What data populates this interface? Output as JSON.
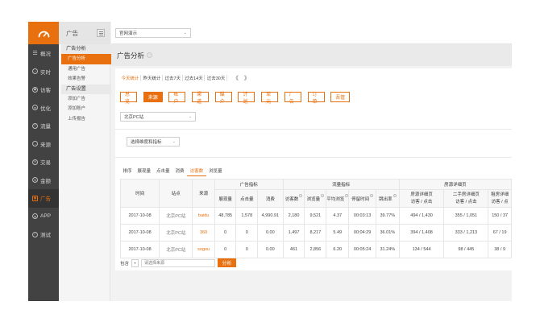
{
  "nav": {
    "items": [
      {
        "icon": "list-icon",
        "glyph": "☰",
        "label": "概况"
      },
      {
        "icon": "clock-icon",
        "glyph": "◔",
        "label": "实时"
      },
      {
        "icon": "visitor-icon",
        "glyph": "◉",
        "label": "访客"
      },
      {
        "icon": "optimize-icon",
        "glyph": "●",
        "label": "优化"
      },
      {
        "icon": "traffic-icon",
        "glyph": "≡",
        "label": "流量"
      },
      {
        "icon": "source-icon",
        "glyph": "→",
        "label": "来源"
      },
      {
        "icon": "deal-icon",
        "glyph": "¥",
        "label": "交易"
      },
      {
        "icon": "amount-icon",
        "glyph": "$",
        "label": "金额"
      },
      {
        "icon": "ad-icon",
        "glyph": "▣",
        "label": "广告"
      },
      {
        "icon": "app-icon",
        "glyph": "▲",
        "label": "APP"
      },
      {
        "icon": "test-icon",
        "glyph": "✓",
        "label": "测试"
      }
    ],
    "active_index": 8,
    "accent": "#e8700f"
  },
  "subnav": {
    "title": "广告",
    "groups": [
      {
        "title": "广告分析",
        "links": [
          "广告分析",
          "通用广告",
          "效果告警"
        ]
      },
      {
        "title": "广告设置",
        "links": [
          "添加广告",
          "添加账户",
          "上传报告"
        ]
      }
    ],
    "active_link": "广告分析"
  },
  "topbar": {
    "site_select": "官网演示"
  },
  "page_title": "广告分析",
  "date_range": {
    "options": [
      "今天统计",
      "昨天统计",
      "过去7天",
      "过去14天",
      "过去30天"
    ],
    "active": 0,
    "prev": "《",
    "next": "》"
  },
  "dimension_tags": [
    "总览",
    "来源",
    "账户",
    "渠道",
    "媒介",
    "计划",
    "单元",
    "广告",
    "订单",
    "吾管"
  ],
  "active_tag": 1,
  "station_select": "北京PC站",
  "dimension_select": "选择维度和指标",
  "metric_tabs": [
    "排序",
    "展现量",
    "点击量",
    "消费",
    "访客数",
    "浏览量"
  ],
  "active_metric_tab": 4,
  "table": {
    "headers": {
      "time": "时间",
      "station": "站点",
      "source": "来源",
      "group_ad": "广告指标",
      "group_flow": "流量指标",
      "group_house": "房源详细页",
      "ad_cols": [
        "展现量",
        "点击量",
        "消费"
      ],
      "flow_cols": [
        "访客数",
        "浏览量",
        "平均浏览",
        "停留时间",
        "跳出率"
      ],
      "house_cols": [
        "房源详细页\n访客 / 点击",
        "二手房详细页\n访客 / 点击",
        "租房详细\n访客 / 点"
      ]
    },
    "rows": [
      {
        "time": "2017-10-08",
        "station": "北京PC站",
        "source": "baidu",
        "impressions": "48,785",
        "clicks": "1,578",
        "cost": "4,990.91",
        "visitors": "2,180",
        "pageviews": "9,521",
        "avg_pv": "4.37",
        "stay": "00:03:13",
        "bounce": "39.77%",
        "house": "494 / 1,430",
        "second_hand": "355 / 1,051",
        "rent": "150 / 37"
      },
      {
        "time": "2017-10-08",
        "station": "北京PC站",
        "source": "360",
        "impressions": "0",
        "clicks": "0",
        "cost": "0.00",
        "visitors": "1,497",
        "pageviews": "8,217",
        "avg_pv": "5.49",
        "stay": "00:04:29",
        "bounce": "36.01%",
        "house": "394 / 1,408",
        "second_hand": "333 / 1,213",
        "rent": "67 / 19"
      },
      {
        "time": "2017-10-08",
        "station": "北京PC站",
        "source": "sogou",
        "impressions": "0",
        "clicks": "0",
        "cost": "0.00",
        "visitors": "461",
        "pageviews": "2,856",
        "avg_pv": "6.20",
        "stay": "00:05:24",
        "bounce": "31.24%",
        "house": "134 / 544",
        "second_hand": "98 / 445",
        "rent": "38 / 9"
      }
    ]
  },
  "search": {
    "label": "包含",
    "mini_select": "▾",
    "placeholder": "请选择来源",
    "button": "分析"
  }
}
